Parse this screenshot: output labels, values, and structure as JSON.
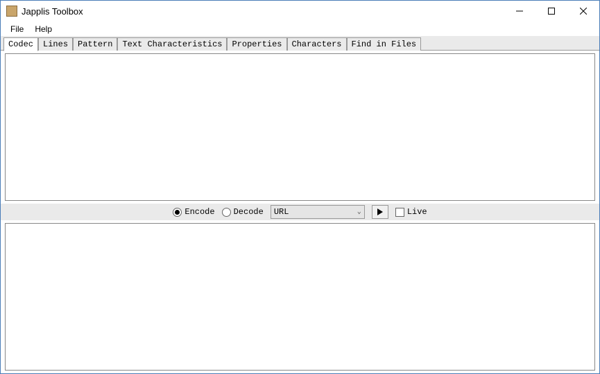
{
  "window": {
    "title": "Japplis Toolbox"
  },
  "menubar": {
    "items": [
      "File",
      "Help"
    ]
  },
  "tabs": {
    "items": [
      "Codec",
      "Lines",
      "Pattern",
      "Text Characteristics",
      "Properties",
      "Characters",
      "Find in Files"
    ],
    "active_index": 0
  },
  "codec": {
    "input_value": "",
    "output_value": "",
    "mode_options": {
      "encode": "Encode",
      "decode": "Decode"
    },
    "mode_selected": "encode",
    "format_selected": "URL",
    "live_label": "Live",
    "live_checked": false
  }
}
